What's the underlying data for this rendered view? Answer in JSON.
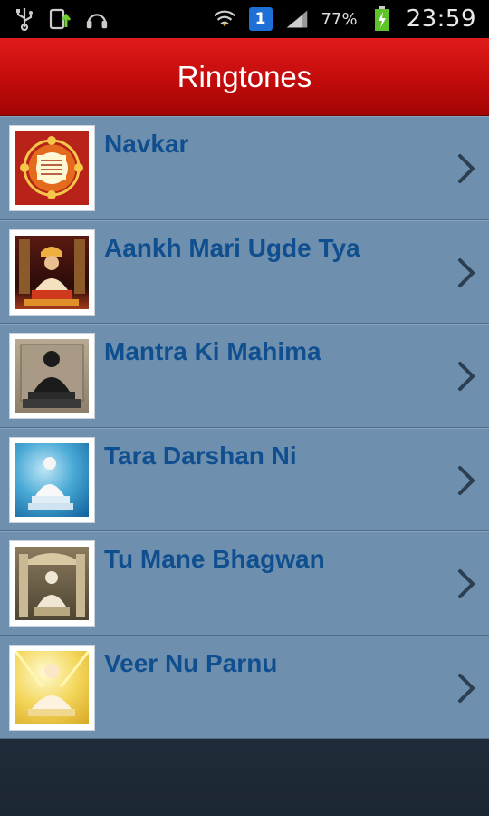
{
  "status_bar": {
    "battery": "77%",
    "time": "23:59",
    "notification_count": "1",
    "icons": [
      "usb-icon",
      "upload-icon",
      "headphones-icon",
      "wifi-icon",
      "notification-badge",
      "signal-icon",
      "battery-icon"
    ]
  },
  "header": {
    "title": "Ringtones"
  },
  "ringtones": [
    {
      "title": "Navkar",
      "thumb": "navkar-thumbnail"
    },
    {
      "title": "Aankh Mari Ugde Tya",
      "thumb": "idol-red-thumbnail"
    },
    {
      "title": "Mantra Ki Mahima",
      "thumb": "idol-black-thumbnail"
    },
    {
      "title": "Tara Darshan Ni",
      "thumb": "idol-blue-thumbnail"
    },
    {
      "title": "Tu Mane Bhagwan",
      "thumb": "idol-temple-thumbnail"
    },
    {
      "title": "Veer Nu Parnu",
      "thumb": "idol-yellow-thumbnail"
    }
  ],
  "colors": {
    "header_red": "#c20b0b",
    "list_bg": "#6e8fae",
    "title_blue": "#0f4f8f"
  }
}
